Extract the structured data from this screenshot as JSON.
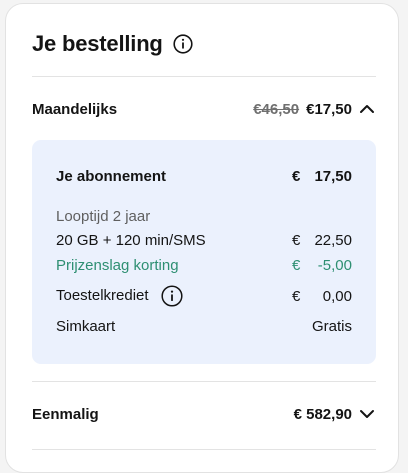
{
  "title": "Je bestelling",
  "monthly": {
    "label": "Maandelijks",
    "old_price": "€46,50",
    "price": "€17,50"
  },
  "subscription": {
    "label": "Je abonnement",
    "currency": "€",
    "amount": "17,50"
  },
  "details": {
    "duration": "Looptijd 2 jaar",
    "plan_label": "20 GB + 120 min/SMS",
    "plan_currency": "€",
    "plan_amount": "22,50",
    "discount_label": "Prijzenslag korting",
    "discount_currency": "€",
    "discount_amount": "-5,00",
    "credit_label": "Toestelkrediet",
    "credit_currency": "€",
    "credit_amount": "0,00",
    "sim_label": "Simkaart",
    "sim_value": "Gratis"
  },
  "oneoff": {
    "label": "Eenmalig",
    "price": "€ 582,90"
  },
  "colors": {
    "panel_bg": "#ebf1fd",
    "discount_green": "#2e8f72"
  }
}
